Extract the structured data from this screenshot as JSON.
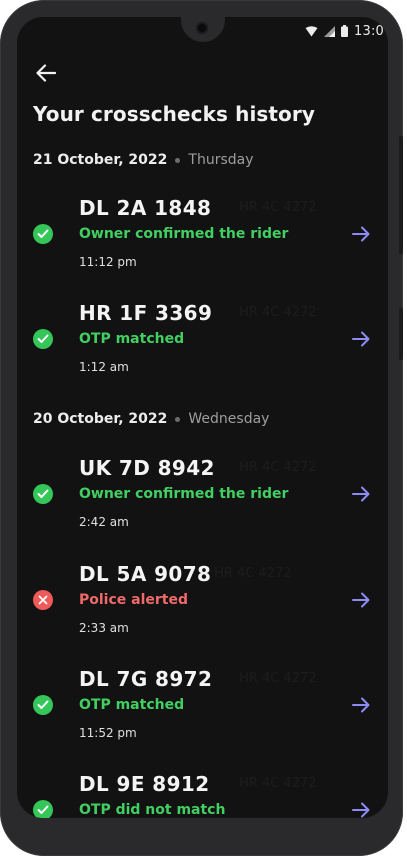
{
  "status_bar": {
    "time": "13:0",
    "icons": [
      "wifi-icon",
      "cellular-signal-icon",
      "battery-icon"
    ]
  },
  "header": {
    "back_icon": "arrow-left-icon",
    "title": "Your crosschecks history"
  },
  "colors": {
    "background": "#121212",
    "success": "#41cf62",
    "danger": "#f06a6a",
    "arrow_accent": "#8d8cf5"
  },
  "sections": [
    {
      "date": "21 October, 2022",
      "day": "Thursday",
      "items": [
        {
          "plate": "DL 2A 1848",
          "ghost": "HR 4C 4272",
          "status": "Owner confirmed the rider",
          "time": "11:12 pm",
          "result": "success"
        },
        {
          "plate": "HR 1F 3369",
          "ghost": "HR 4C 4272",
          "status": "OTP matched",
          "time": "1:12 am",
          "result": "success"
        }
      ]
    },
    {
      "date": "20 October, 2022",
      "day": "Wednesday",
      "items": [
        {
          "plate": "UK 7D 8942",
          "ghost": "HR 4C 4272",
          "status": "Owner confirmed the rider",
          "time": "2:42 am",
          "result": "success"
        },
        {
          "plate": "DL 5A 9078",
          "ghost": "HR 4C 4272",
          "status": "Police alerted",
          "time": "2:33 am",
          "result": "failure"
        },
        {
          "plate": "DL 7G 8972",
          "ghost": "HR 4C 4272",
          "status": "OTP matched",
          "time": "11:52 pm",
          "result": "success"
        },
        {
          "plate": "DL 9E 8912",
          "ghost": "HR 4C 4272",
          "status": "OTP did not match",
          "time": "",
          "result": "success"
        }
      ]
    }
  ]
}
